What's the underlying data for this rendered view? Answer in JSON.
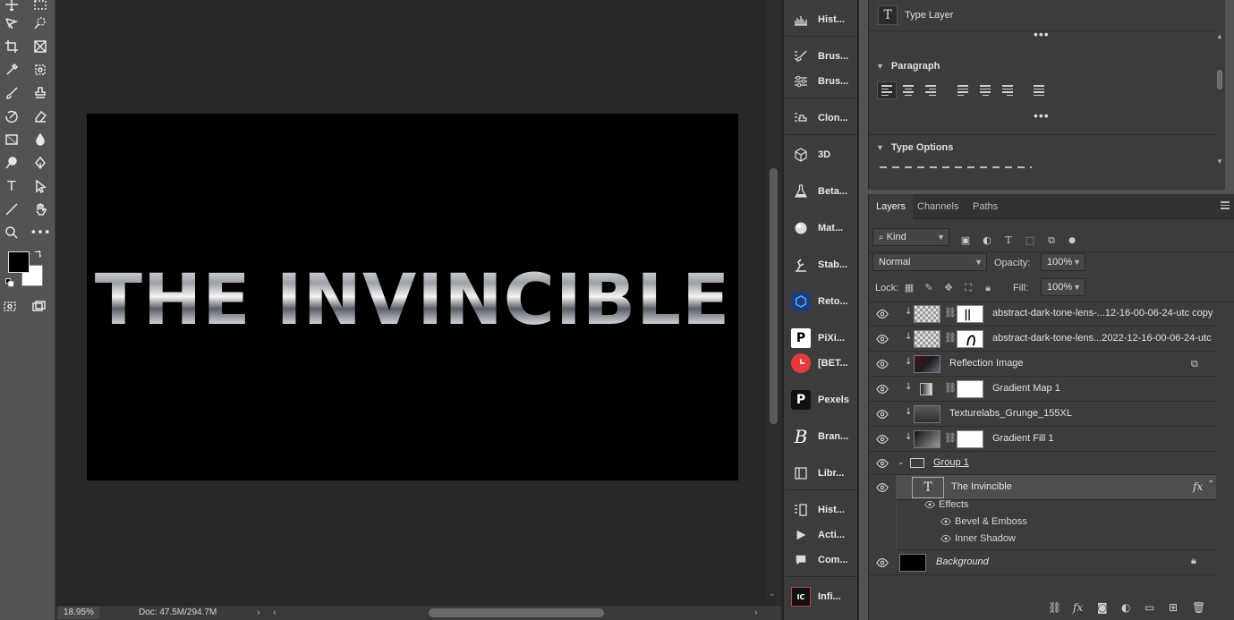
{
  "canvas": {
    "artwork_text": "THE INVINCIBLE",
    "zoom": "18.95%",
    "doc_info": "Doc: 47.5M/294.7M"
  },
  "tools": {
    "type_tool_glyph": "T"
  },
  "dock": {
    "items": [
      {
        "icon": "histogram-icon",
        "label": "Hist..."
      },
      {
        "icon": "brush-icon",
        "label": "Brus..."
      },
      {
        "icon": "brush-settings-icon",
        "label": "Brus..."
      },
      {
        "icon": "clone-source-icon",
        "label": "Clon..."
      },
      {
        "icon": "3d-icon",
        "label": "3D"
      },
      {
        "icon": "beta-flask-icon",
        "label": "Beta..."
      },
      {
        "icon": "materials-icon",
        "label": "Mat..."
      },
      {
        "icon": "stabilizer-icon",
        "label": "Stab..."
      },
      {
        "icon": "retouch-icon",
        "label": "Reto..."
      },
      {
        "icon": "pixivisor-icon",
        "label": "PiXi..."
      },
      {
        "icon": "beta-plugin-icon",
        "label": "[BET..."
      },
      {
        "icon": "pexels-icon",
        "label": "Pexels"
      },
      {
        "icon": "brand-icon",
        "label": "Bran..."
      },
      {
        "icon": "libraries-icon",
        "label": "Libr..."
      },
      {
        "icon": "history-icon",
        "label": "Hist..."
      },
      {
        "icon": "actions-play-icon",
        "label": "Acti..."
      },
      {
        "icon": "comments-icon",
        "label": "Com..."
      },
      {
        "icon": "info-icon",
        "label": "Infi..."
      }
    ],
    "glyphs": {
      "pexels": "P",
      "brand": "B",
      "ic": "IC",
      "pixi": "P"
    }
  },
  "properties": {
    "layer_kind": "Type Layer",
    "type_icon_glyph": "T",
    "paragraph_title": "Paragraph",
    "type_options_title": "Type Options"
  },
  "layers_panel": {
    "tabs": [
      "Layers",
      "Channels",
      "Paths"
    ],
    "kind_label": "Kind",
    "blend_mode": "Normal",
    "opacity_label": "Opacity:",
    "opacity_value": "100%",
    "lock_label": "Lock:",
    "fill_label": "Fill:",
    "fill_value": "100%",
    "layers": [
      {
        "name": "abstract-dark-tone-lens-...12-16-00-06-24-utc copy",
        "mask": "black-stroke"
      },
      {
        "name": "abstract-dark-tone-lens...2022-12-16-00-06-24-utc",
        "mask": "black-stroke"
      },
      {
        "name": "Reflection Image",
        "mask": "none"
      },
      {
        "name": "Gradient Map 1",
        "mask": "white"
      },
      {
        "name": "Texturelabs_Grunge_155XL",
        "mask": "none"
      },
      {
        "name": "Gradient Fill 1",
        "mask": "white"
      },
      {
        "name": "Group 1",
        "mask": "none"
      },
      {
        "name": "The Invincible",
        "mask": "none"
      },
      {
        "name": "Background",
        "mask": "none"
      }
    ],
    "effects_label": "Effects",
    "effect_items": [
      "Bevel & Emboss",
      "Inner Shadow"
    ],
    "fx_label": "fx"
  }
}
